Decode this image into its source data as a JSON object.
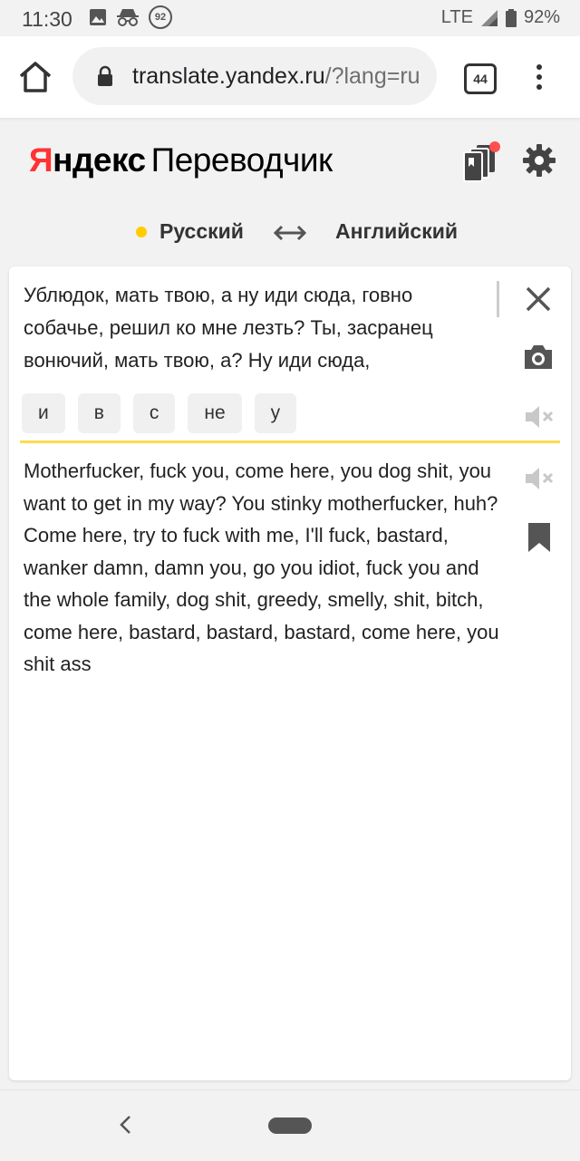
{
  "status": {
    "time": "11:30",
    "notification_badge": "92",
    "network": "LTE",
    "battery": "92%"
  },
  "browser": {
    "url_host": "translate.yandex.ru",
    "url_path": "/?lang=ru",
    "tab_count": "44"
  },
  "header": {
    "logo_ya": "Я",
    "logo_rest": "ндекс",
    "product": "Переводчик",
    "accent_color": "#ff3333",
    "notification_dot_color": "#ff4f4f"
  },
  "languages": {
    "source": "Русский",
    "target": "Английский",
    "source_dot_color": "#ffcc00"
  },
  "input": {
    "text": "Ублюдок, мать твою, а ну иди сюда, говно собачье, решил ко мне лезть? Ты, засранец вонючий, мать твою, а? Ну иди сюда,",
    "suggestions": [
      "и",
      "в",
      "с",
      "не",
      "у"
    ]
  },
  "output": {
    "text": "Motherfucker, fuck you, come here, you dog shit, you want to get in my way? You stinky motherfucker, huh? Come here, try to fuck with me, I'll fuck, bastard, wanker damn, damn you, go you idiot, fuck you and the whole family, dog shit, greedy, smelly, shit, bitch, come here, bastard, bastard, bastard, come here, you shit ass"
  },
  "icons": {
    "home": "home-icon",
    "lock": "lock-icon",
    "menu": "more-vert-icon",
    "collections": "collections-icon",
    "settings": "gear-icon",
    "swap": "swap-arrows-icon",
    "clear": "close-icon",
    "camera": "camera-icon",
    "speaker_muted": "speaker-muted-icon",
    "bookmark": "bookmark-icon"
  }
}
